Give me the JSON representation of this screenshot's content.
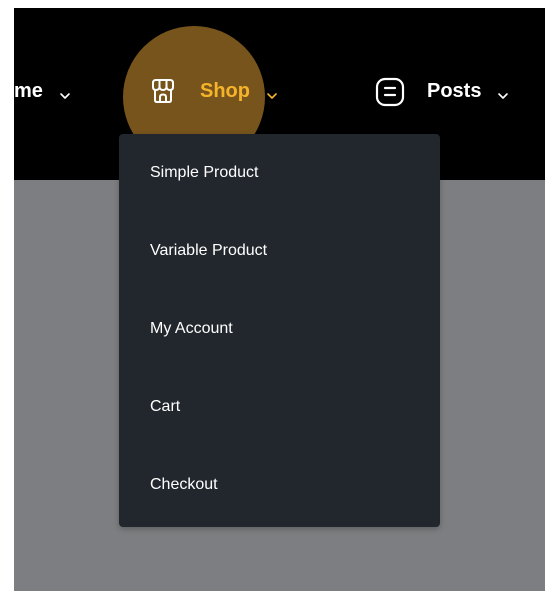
{
  "nav": {
    "items": [
      {
        "label": "me",
        "icon": "chevron-down-icon",
        "active": false
      },
      {
        "label": "Shop",
        "icon": "store-icon",
        "active": true
      },
      {
        "label": "Posts",
        "icon": "posts-icon",
        "active": false
      }
    ],
    "active_color": "#f5b42a"
  },
  "shop_menu": {
    "items": [
      {
        "label": "Simple Product"
      },
      {
        "label": "Variable Product"
      },
      {
        "label": "My Account"
      },
      {
        "label": "Cart"
      },
      {
        "label": "Checkout"
      }
    ]
  },
  "colors": {
    "navbar_bg": "#000000",
    "content_bg": "#7d7e81",
    "dropdown_bg": "#22262d",
    "highlight": "#a67428"
  }
}
